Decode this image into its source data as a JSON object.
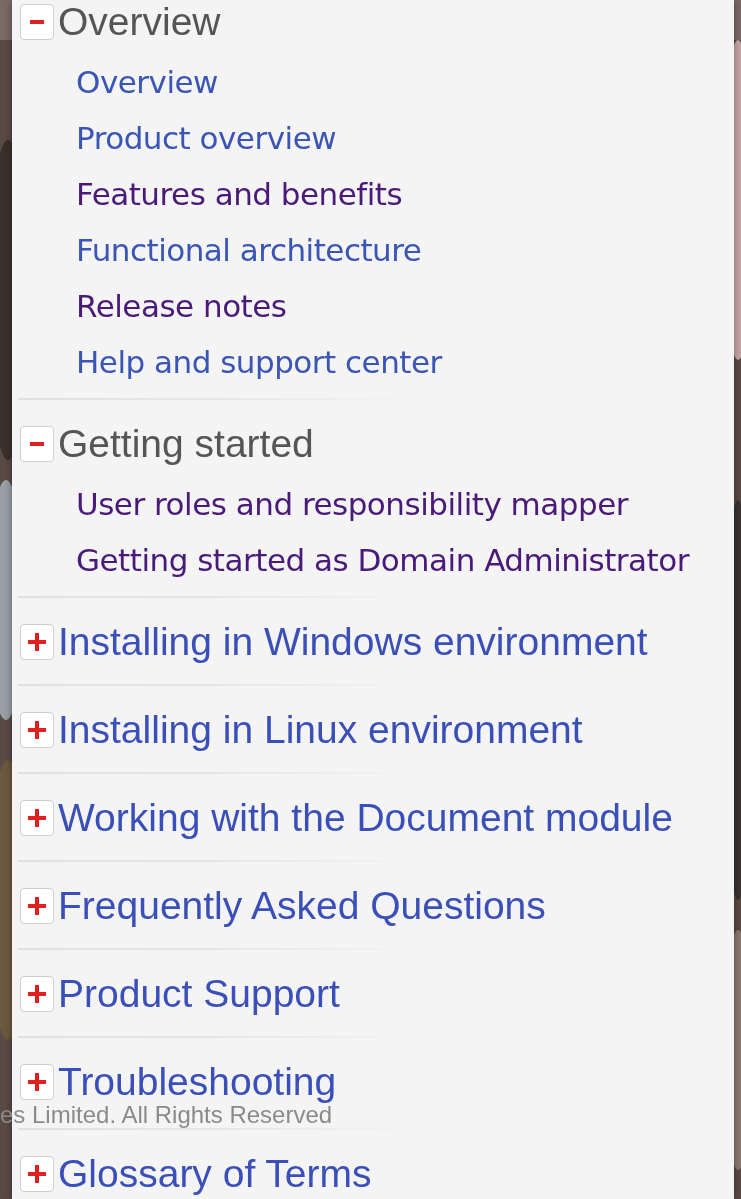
{
  "sections": [
    {
      "title": "Overview",
      "expanded": true,
      "children": [
        {
          "label": "Overview",
          "visited": false
        },
        {
          "label": "Product overview",
          "visited": false
        },
        {
          "label": "Features and benefits",
          "visited": true
        },
        {
          "label": "Functional architecture",
          "visited": false
        },
        {
          "label": "Release notes",
          "visited": true
        },
        {
          "label": "Help and support center",
          "visited": false
        }
      ]
    },
    {
      "title": "Getting started",
      "expanded": true,
      "children": [
        {
          "label": "User roles and responsibility mapper",
          "visited": true
        },
        {
          "label": "Getting started as Domain Administrator",
          "visited": true
        }
      ]
    },
    {
      "title": "Installing in Windows environment",
      "expanded": false
    },
    {
      "title": "Installing in Linux environment",
      "expanded": false
    },
    {
      "title": "Working with the Document module",
      "expanded": false
    },
    {
      "title": "Frequently Asked Questions",
      "expanded": false
    },
    {
      "title": "Product Support",
      "expanded": false
    },
    {
      "title": "Troubleshooting",
      "expanded": false
    },
    {
      "title": "Glossary of Terms",
      "expanded": false
    }
  ],
  "footer": "es Limited. All Rights Reserved"
}
